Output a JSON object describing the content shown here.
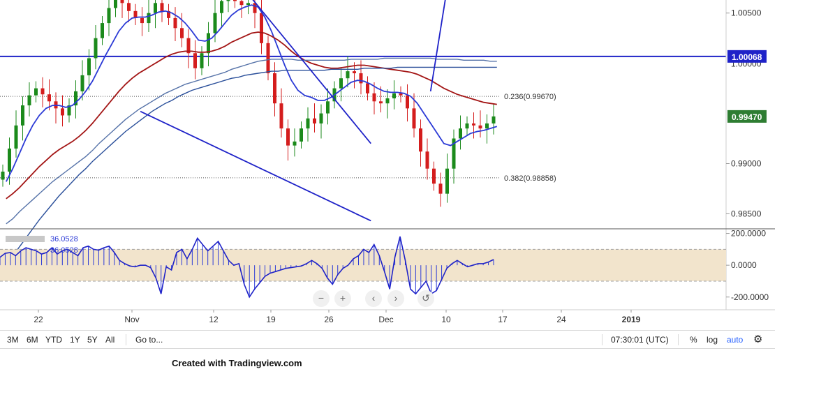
{
  "chart_data": [
    {
      "type": "line",
      "title": "",
      "xlabel": "",
      "ylabel": "",
      "x_ticks": [
        "22",
        "Nov",
        "12",
        "19",
        "26",
        "Dec",
        "10",
        "17",
        "24",
        "2019"
      ],
      "y_ticks": [
        "1.00500",
        "0.99000",
        "0.98500"
      ],
      "ylim": [
        0.9835,
        1.0063
      ],
      "price_markers": [
        {
          "label": "1.00068",
          "value": 1.00068,
          "color": "#1e22c8"
        },
        {
          "label": "0.99470",
          "value": 0.9947,
          "color": "#2e7d32"
        }
      ],
      "price_marker_under_label": "1.00000",
      "fib_levels": [
        {
          "label": "0.236(0.99670)",
          "value": 0.9967
        },
        {
          "label": "0.382(0.98858)",
          "value": 0.98858
        }
      ],
      "series": [
        {
          "values": [
            0.9892,
            0.9915,
            0.9938,
            0.9958,
            0.9968,
            0.9975,
            0.9969,
            0.9962,
            0.9955,
            0.9948,
            0.9958,
            0.9972,
            0.9988,
            1.0005,
            1.0025,
            1.004,
            1.0055,
            1.0065,
            1.006,
            1.0052,
            1.0045,
            1.004,
            1.005,
            1.006,
            1.0052,
            1.0045,
            1.0035,
            1.0025,
            1.001,
            0.9995,
            1.001,
            1.003,
            1.005,
            1.0062,
            1.0068,
            1.0062,
            1.0058,
            1.006,
            1.005,
            1.002,
            0.999,
            0.996,
            0.9935,
            0.9918,
            0.9922,
            0.9935,
            0.9945,
            0.994,
            0.995,
            0.9962,
            0.9975,
            0.9985,
            0.9992,
            0.999,
            0.998,
            0.997,
            0.9962,
            0.996,
            0.9965,
            0.997,
            0.9968,
            0.9955,
            0.9935,
            0.9912,
            0.9895,
            0.988,
            0.987,
            0.9895,
            0.9925,
            0.9935,
            0.994,
            0.9938,
            0.9935,
            0.994,
            0.9947
          ]
        },
        {
          "values": [
            0.9882,
            0.9895,
            0.991,
            0.9925,
            0.9938,
            0.9948,
            0.9955,
            0.9958,
            0.9958,
            0.9956,
            0.9958,
            0.9964,
            0.9972,
            0.9982,
            0.9995,
            1.0008,
            1.002,
            1.0032,
            1.004,
            1.0045,
            1.0046,
            1.0046,
            1.0048,
            1.0051,
            1.0052,
            1.005,
            1.0046,
            1.004,
            1.0032,
            1.0023,
            1.0022,
            1.0025,
            1.0032,
            1.004,
            1.0048,
            1.0053,
            1.0056,
            1.0058,
            1.0056,
            1.0046,
            1.0032,
            1.0015,
            0.9998,
            0.9983,
            0.9973,
            0.9968,
            0.9966,
            0.9963,
            0.9963,
            0.9966,
            0.9971,
            0.9976,
            0.9981,
            0.9983,
            0.9982,
            0.9979,
            0.9975,
            0.9972,
            0.9971,
            0.9971,
            0.997,
            0.9967,
            0.996,
            0.995,
            0.994,
            0.993,
            0.992,
            0.9918,
            0.9922,
            0.9926,
            0.993,
            0.9932,
            0.9933,
            0.9935,
            0.9937
          ]
        },
        {
          "values": [
            0.9865,
            0.987,
            0.9876,
            0.9883,
            0.989,
            0.9897,
            0.9903,
            0.9909,
            0.9914,
            0.9918,
            0.9922,
            0.9927,
            0.9933,
            0.994,
            0.9948,
            0.9956,
            0.9964,
            0.9972,
            0.9979,
            0.9985,
            0.999,
            0.9994,
            0.9998,
            1.0002,
            1.0006,
            1.0009,
            1.0011,
            1.0012,
            1.0012,
            1.0011,
            1.0011,
            1.0012,
            1.0014,
            1.0017,
            1.0021,
            1.0024,
            1.0027,
            1.003,
            1.0031,
            1.003,
            1.0027,
            1.0023,
            1.0018,
            1.0012,
            1.0007,
            1.0003,
            1.0,
            0.9998,
            0.9996,
            0.9995,
            0.9995,
            0.9996,
            0.9997,
            0.9998,
            0.9998,
            0.9997,
            0.9996,
            0.9995,
            0.9994,
            0.9993,
            0.9992,
            0.9991,
            0.9989,
            0.9986,
            0.9983,
            0.9979,
            0.9975,
            0.9972,
            0.9969,
            0.9967,
            0.9965,
            0.9963,
            0.9961,
            0.996,
            0.9959
          ]
        },
        {
          "values": [
            0.984,
            0.9845,
            0.9852,
            0.9858,
            0.9864,
            0.987,
            0.9876,
            0.9882,
            0.9887,
            0.9892,
            0.9897,
            0.9902,
            0.9907,
            0.9913,
            0.992,
            0.9926,
            0.9932,
            0.9938,
            0.9944,
            0.9949,
            0.9954,
            0.9958,
            0.9962,
            0.9966,
            0.997,
            0.9973,
            0.9976,
            0.9979,
            0.9981,
            0.9983,
            0.9985,
            0.9987,
            0.9989,
            0.9991,
            0.9994,
            0.9996,
            0.9998,
            1.0,
            1.0002,
            1.0003,
            1.0004,
            1.0004,
            1.0004,
            1.0004,
            1.0003,
            1.0003,
            1.0003,
            1.0003,
            1.0003,
            1.0003,
            1.0003,
            1.0003,
            1.0004,
            1.0004,
            1.0004,
            1.0004,
            1.0004,
            1.0005,
            1.0005,
            1.0005,
            1.0005,
            1.0005,
            1.0005,
            1.0005,
            1.0005,
            1.0004,
            1.0004,
            1.0004,
            1.0004,
            1.0003,
            1.0003,
            1.0003,
            1.0003,
            1.0002,
            1.0002
          ]
        },
        {
          "values": [
            0.98,
            0.9808,
            0.9817,
            0.9826,
            0.9835,
            0.9844,
            0.9852,
            0.986,
            0.9868,
            0.9875,
            0.9882,
            0.9889,
            0.9895,
            0.9902,
            0.9908,
            0.9914,
            0.992,
            0.9926,
            0.9932,
            0.9937,
            0.9942,
            0.9947,
            0.9952,
            0.9956,
            0.996,
            0.9963,
            0.9967,
            0.997,
            0.9973,
            0.9975,
            0.9977,
            0.9979,
            0.9981,
            0.9983,
            0.9985,
            0.9986,
            0.9988,
            0.9989,
            0.999,
            0.9991,
            0.9992,
            0.9992,
            0.9993,
            0.9993,
            0.9993,
            0.9993,
            0.9993,
            0.9993,
            0.9993,
            0.9994,
            0.9994,
            0.9994,
            0.9994,
            0.9994,
            0.9995,
            0.9995,
            0.9995,
            0.9995,
            0.9995,
            0.9996,
            0.9996,
            0.9996,
            0.9996,
            0.9996,
            0.9996,
            0.9996,
            0.9996,
            0.9996,
            0.9996,
            0.9996,
            0.9996,
            0.9996,
            0.9996,
            0.9996,
            0.9996
          ]
        }
      ],
      "trendlines": [
        {
          "from": [
            8.3,
            0.9952
          ],
          "to": [
            22.2,
            0.9843
          ]
        },
        {
          "from": [
            14.5,
            1.0075
          ],
          "to": [
            22.2,
            0.992
          ]
        },
        {
          "from": [
            25.8,
            0.9972
          ],
          "to": [
            26.8,
            1.0075
          ]
        }
      ]
    },
    {
      "type": "area",
      "title": "",
      "y_ticks": [
        "200.0000",
        "0.0000",
        "-200.0000"
      ],
      "ylim": [
        -280,
        220
      ],
      "band": [
        -100,
        100
      ],
      "legend": [
        "36.0528",
        "36.0528"
      ],
      "values": [
        50,
        75,
        80,
        60,
        90,
        110,
        100,
        90,
        70,
        80,
        110,
        70,
        90,
        100,
        80,
        60,
        110,
        120,
        100,
        95,
        110,
        120,
        80,
        30,
        10,
        -5,
        -10,
        0,
        0,
        -15,
        -80,
        -180,
        -10,
        -30,
        80,
        100,
        40,
        100,
        170,
        130,
        90,
        120,
        150,
        90,
        30,
        0,
        10,
        -120,
        -200,
        -150,
        -110,
        -70,
        -50,
        -40,
        -30,
        -20,
        -15,
        -10,
        -5,
        10,
        30,
        10,
        -20,
        -80,
        -120,
        -60,
        -20,
        0,
        40,
        60,
        100,
        80,
        130,
        60,
        -40,
        -150,
        50,
        180,
        30,
        -150,
        -180,
        -140,
        -100,
        -180,
        -160,
        -90,
        -20,
        10,
        30,
        10,
        -10,
        0,
        10,
        10,
        20,
        36
      ]
    }
  ],
  "bottom_bar": {
    "ranges": [
      "3M",
      "6M",
      "YTD",
      "1Y",
      "5Y",
      "All"
    ],
    "goto": "Go to...",
    "time": "07:30:01 (UTC)",
    "percent": "%",
    "log": "log",
    "auto": "auto"
  },
  "nav": {
    "minus": "−",
    "plus": "+",
    "back": "‹",
    "forward": "›",
    "reset": "↺"
  },
  "credit": "Created with Tradingview.com",
  "colors": {
    "ma_blue": "#2b3ad6",
    "ma_red": "#a31515",
    "ma_steel": "#5572a8",
    "ma_navy": "#2a4f9a",
    "line_blue": "#1e22c8",
    "band": "#f2e4cc",
    "up": "#1b8a1b",
    "down": "#d41d1d"
  }
}
